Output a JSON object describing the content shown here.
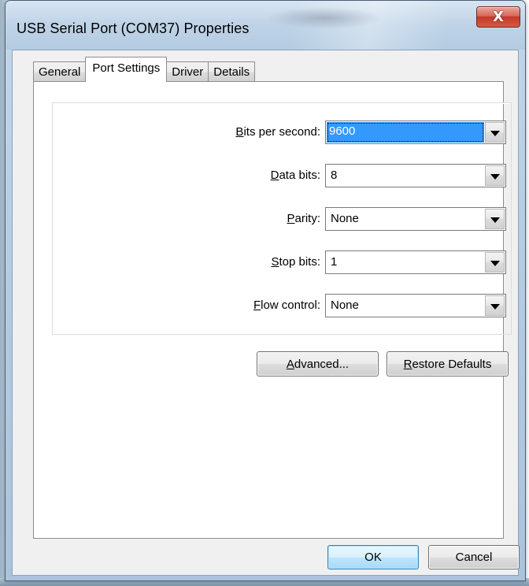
{
  "window": {
    "title": "USB Serial Port (COM37) Properties",
    "close_glyph": "X"
  },
  "tabs": [
    {
      "label": "General",
      "active": false
    },
    {
      "label": "Port Settings",
      "active": true
    },
    {
      "label": "Driver",
      "active": false
    },
    {
      "label": "Details",
      "active": false
    }
  ],
  "port_settings": {
    "fields": [
      {
        "label": "Bits per second:",
        "mnemonic": "B",
        "label_rest": "its per second:",
        "value": "9600",
        "focused": true
      },
      {
        "label": "Data bits:",
        "mnemonic": "D",
        "label_rest": "ata bits:",
        "value": "8",
        "focused": false
      },
      {
        "label": "Parity:",
        "mnemonic": "P",
        "label_rest": "arity:",
        "value": "None",
        "focused": false
      },
      {
        "label": "Stop bits:",
        "mnemonic": "S",
        "label_rest": "top bits:",
        "value": "1",
        "focused": false
      },
      {
        "label": "Flow control:",
        "mnemonic": "F",
        "label_rest": "low control:",
        "value": "None",
        "focused": false
      }
    ],
    "advanced_button": {
      "mnemonic": "A",
      "rest": "dvanced..."
    },
    "restore_button": {
      "mnemonic": "R",
      "rest": "estore Defaults"
    }
  },
  "footer": {
    "ok_label": "OK",
    "cancel_label": "Cancel"
  },
  "icons": {
    "dropdown": "chevron-down-icon",
    "close": "close-icon"
  },
  "colors": {
    "selection": "#3399ff",
    "close_button": "#c5382a",
    "default_button_border": "#3c7fb1"
  }
}
